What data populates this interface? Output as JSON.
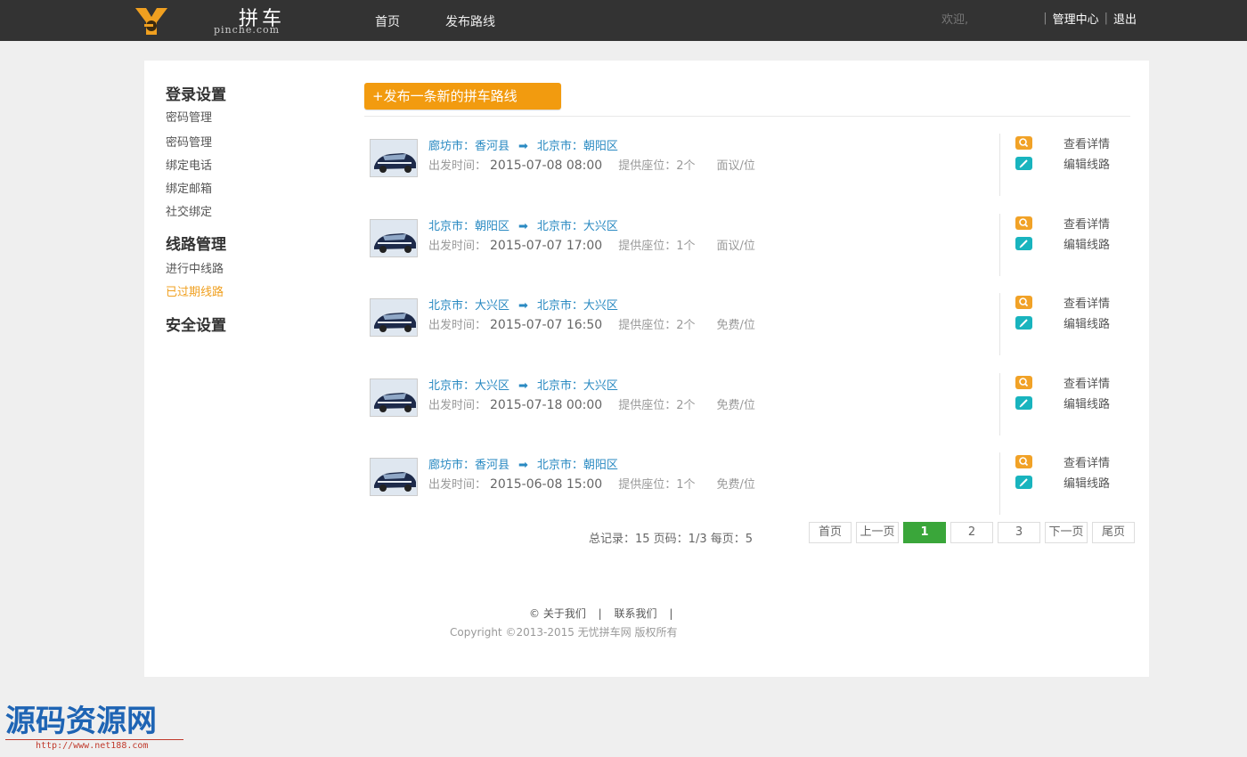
{
  "header": {
    "logo_text": "拼车",
    "logo_sub": "pinche.com",
    "nav": [
      "首页",
      "发布路线"
    ],
    "welcome": "欢迎,",
    "admin_center": "管理中心",
    "logout": "退出"
  },
  "sidebar": {
    "groups": [
      {
        "heading": "登录设置",
        "items": [
          "密码管理",
          "密码管理",
          "绑定电话",
          "绑定邮箱",
          "社交绑定"
        ]
      },
      {
        "heading": "线路管理",
        "items": [
          "进行中线路",
          "已过期线路"
        ],
        "active": "已过期线路"
      },
      {
        "heading": "安全设置",
        "items": []
      }
    ]
  },
  "publish_button": "+发布一条新的拼车路线",
  "route_labels": {
    "depart": "出发时间：",
    "seats_prefix": "提供座位：",
    "arrow": "➡"
  },
  "routes": [
    {
      "from": "廊坊市：香河县",
      "to": "北京市：朝阳区",
      "time": "2015-07-08 08:00",
      "seats": "2个",
      "price": "面议/位"
    },
    {
      "from": "北京市：朝阳区",
      "to": "北京市：大兴区",
      "time": "2015-07-07 17:00",
      "seats": "1个",
      "price": "面议/位"
    },
    {
      "from": "北京市：大兴区",
      "to": "北京市：大兴区",
      "time": "2015-07-07 16:50",
      "seats": "2个",
      "price": "免费/位"
    },
    {
      "from": "北京市：大兴区",
      "to": "北京市：大兴区",
      "time": "2015-07-18 00:00",
      "seats": "2个",
      "price": "免费/位"
    },
    {
      "from": "廊坊市：香河县",
      "to": "北京市：朝阳区",
      "time": "2015-06-08 15:00",
      "seats": "1个",
      "price": "免费/位"
    }
  ],
  "actions": {
    "view": "查看详情",
    "edit": "编辑线路",
    "view_icon": "search-icon",
    "edit_icon": "pencil-icon",
    "view_color": "#f1a227",
    "edit_color": "#19b4be"
  },
  "pagination": {
    "summary": "总记录：15 页码：1/3 每页：5",
    "first": "首页",
    "prev": "上一页",
    "pages": [
      "1",
      "2",
      "3"
    ],
    "current": "1",
    "next": "下一页",
    "last": "尾页"
  },
  "footer": {
    "copyright_symbol": "©",
    "about": "关于我们",
    "contact": "联系我们",
    "sep": "|",
    "copyright": "Copyright ©2013-2015 无忧拼车网 版权所有"
  },
  "watermark": {
    "title": "源码资源网",
    "url": "http://www.net188.com"
  },
  "colors": {
    "topbar": "#333333",
    "accent_orange": "#f29b0f",
    "link_blue": "#2a8ac2",
    "page_active_green": "#3aa63a",
    "sidebar_active": "#f0a020"
  }
}
